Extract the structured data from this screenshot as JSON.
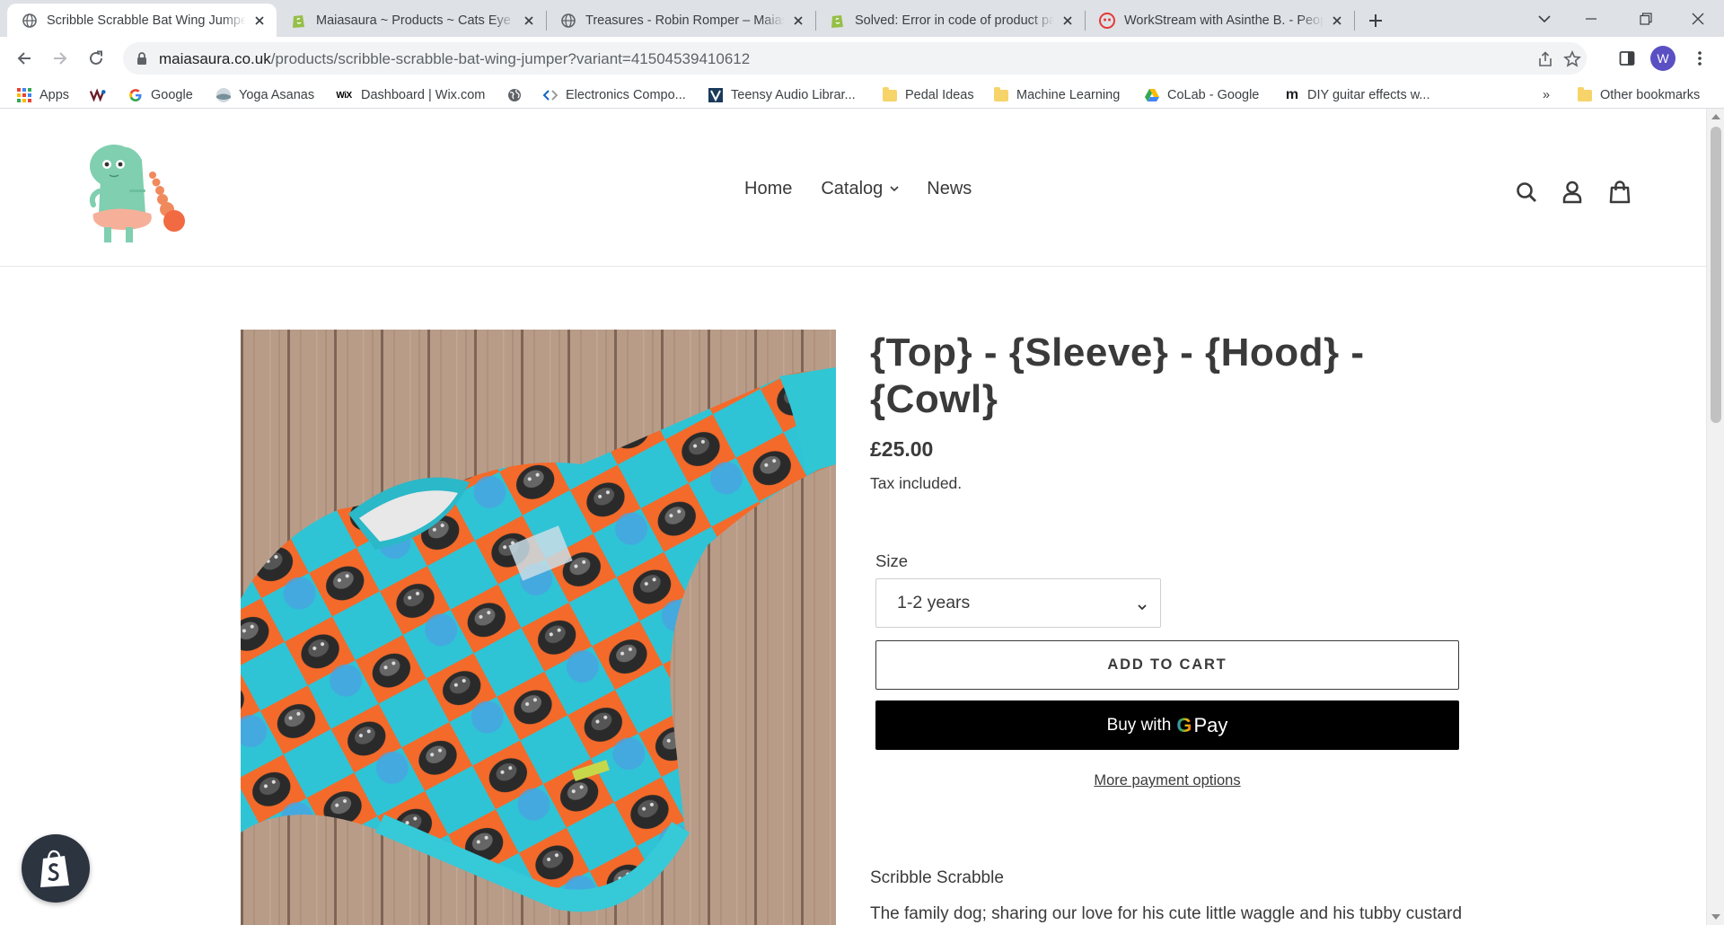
{
  "browser": {
    "tabs": [
      {
        "title": "Scribble Scrabble Bat Wing Jumper",
        "icon": "globe-icon",
        "active": true
      },
      {
        "title": "Maiasaura ~ Products ~ Cats Eye",
        "icon": "shopify-icon",
        "active": false
      },
      {
        "title": "Treasures - Robin Romper – Maiasaura",
        "icon": "globe-icon",
        "active": false
      },
      {
        "title": "Solved: Error in code of product page",
        "icon": "shopify-icon",
        "active": false
      },
      {
        "title": "WorkStream with Asinthe B. - Peopleperhour",
        "icon": "workstream-icon",
        "active": false
      }
    ],
    "url_host": "maiasaura.co.uk",
    "url_path": "/products/scribble-scrabble-bat-wing-jumper?variant=41504539410612",
    "profile_initial": "W",
    "bookmarks": [
      {
        "label": "Apps",
        "icon": "apps-grid-icon"
      },
      {
        "label": "",
        "icon": "bookmark-logo-icon"
      },
      {
        "label": "Google",
        "icon": "google-icon"
      },
      {
        "label": "Yoga Asanas",
        "icon": "yoga-icon"
      },
      {
        "label": "Dashboard | Wix.com",
        "icon": "wix-icon"
      },
      {
        "label": "",
        "icon": "globe-icon"
      },
      {
        "label": "Electronics Compo...",
        "icon": "code-icon"
      },
      {
        "label": "Teensy Audio Librar...",
        "icon": "teensy-icon"
      },
      {
        "label": "Pedal Ideas",
        "icon": "folder-icon"
      },
      {
        "label": "Machine Learning",
        "icon": "folder-icon"
      },
      {
        "label": "CoLab - Google",
        "icon": "drive-icon"
      },
      {
        "label": "DIY guitar effects w...",
        "icon": "m-icon"
      }
    ],
    "bookmarks_overflow": "»",
    "other_bookmarks": "Other bookmarks"
  },
  "site": {
    "nav": {
      "home": "Home",
      "catalog": "Catalog",
      "news": "News"
    },
    "icons": [
      "search-icon",
      "account-icon",
      "cart-icon"
    ]
  },
  "product": {
    "title": "{Top} - {Sleeve} - {Hood} - {Cowl}",
    "price": "£25.00",
    "tax_note": "Tax included.",
    "size_label": "Size",
    "size_selected": "1-2 years",
    "add_to_cart": "ADD TO CART",
    "buy_with": "Buy with",
    "gpay_g": "G",
    "gpay_pay": "Pay",
    "more_payment_options": "More payment options",
    "description_title": "Scribble Scrabble",
    "description_start": "The family dog; sharing our love for his cute little waggle and his tubby custard"
  },
  "colors": {
    "accent_dark": "#3a3a3a",
    "gpay_bg": "#000000",
    "sweater_teal": "#2ec4d6",
    "sweater_orange": "#f46a2a",
    "shopify_badge": "#2c3440"
  }
}
